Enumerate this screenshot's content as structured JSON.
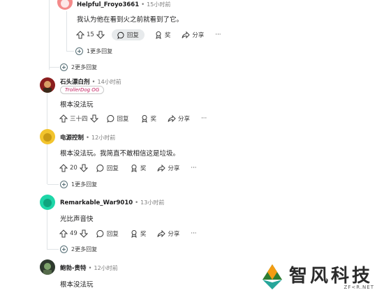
{
  "comments": [
    {
      "username": "Helpful_Froyo3661",
      "time": "15小时前",
      "text": "我认为他在看到火之前就看到了它。",
      "votes": "15",
      "reply_label": "回复",
      "award_label": "奖",
      "share_label": "分享",
      "more_label": "···",
      "more_replies": "1更多回复",
      "avatar_color": "#f48a8a"
    },
    {
      "username": "石头漂白剂",
      "time": "14小时前",
      "flair": "TrollerDog OG",
      "text": "根本没法玩",
      "votes": "三十四",
      "reply_label": "回复",
      "award_label": "奖",
      "share_label": "分享",
      "more_label": "···",
      "avatar_color": "#8b1e1e"
    },
    {
      "username": "电源控制",
      "time": "12小时前",
      "text": "根本没法玩。我简直不敢相信这是垃圾。",
      "votes": "20",
      "reply_label": "回复",
      "award_label": "奖",
      "share_label": "分享",
      "more_label": "···",
      "more_replies": "1更多回复",
      "avatar_color": "#f2c42d"
    },
    {
      "username": "Remarkable_War9010",
      "time": "13小时前",
      "text": "光比声音快",
      "votes": "49",
      "reply_label": "回复",
      "award_label": "奖",
      "share_label": "分享",
      "more_label": "···",
      "more_replies": "2更多回复",
      "avatar_color": "#1ed6a8"
    },
    {
      "username": "鲍勃-贵特",
      "time": "12小时前",
      "text": "根本没法玩",
      "avatar_color": "#2e3a2e"
    }
  ],
  "more_replies_top": "2更多回复",
  "watermark": {
    "title": "智风科技",
    "subtitle": "ZF<R.NET",
    "colors": [
      "#2e7d32",
      "#f39c12",
      "#26a69a"
    ]
  }
}
